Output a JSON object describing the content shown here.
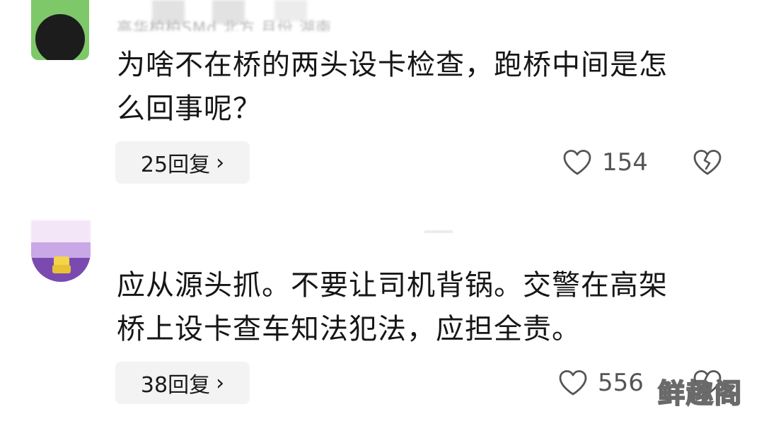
{
  "comments": [
    {
      "username_blurred": "高华柏柏SMd 北方 月份 湖南",
      "text_line1": "为啥不在桥的两头设卡检查，跑桥中间是怎",
      "text_line2": "么回事呢？",
      "replies_label": "25回复",
      "likes": "154"
    },
    {
      "text_line1": "应从源头抓。不要让司机背锅。交警在高架",
      "text_line2": "桥上设卡查车知法犯法，应担全责。",
      "replies_label": "38回复",
      "likes": "556"
    }
  ],
  "chevron": "›",
  "watermark": "鲜趣阁",
  "icons": {
    "like": "heart-outline-icon",
    "dislike": "broken-heart-icon"
  },
  "colors": {
    "text": "#161616",
    "pill_bg": "#f3f3f3",
    "count": "#555555",
    "avatar1": "#7ec86a",
    "avatar2": "#7b4ab0"
  }
}
